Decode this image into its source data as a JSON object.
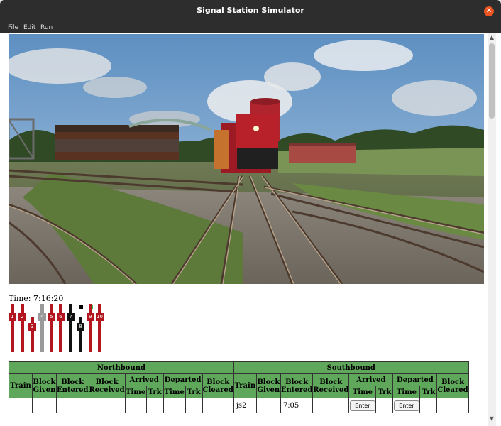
{
  "window": {
    "title": "Signal Station Simulator"
  },
  "menu": [
    "File",
    "Edit",
    "Run"
  ],
  "clock": {
    "label": "Time:",
    "value": "7:16:20"
  },
  "levers": [
    {
      "num": "1",
      "color": "#b3161f",
      "state": "normal"
    },
    {
      "num": "2",
      "color": "#b3161f",
      "state": "normal"
    },
    {
      "num": "3",
      "color": "#b3161f",
      "state": "reversed"
    },
    {
      "num": "4",
      "color": "#9a9a9a",
      "state": "normal"
    },
    {
      "num": "5",
      "color": "#b3161f",
      "state": "normal"
    },
    {
      "num": "6",
      "color": "#b3161f",
      "state": "normal"
    },
    {
      "num": "7",
      "color": "#111111",
      "state": "normal"
    },
    {
      "num": "8",
      "color": "#111111",
      "state": "reversed"
    },
    {
      "num": "9",
      "color": "#b3161f",
      "state": "normal"
    },
    {
      "num": "10",
      "color": "#b3161f",
      "state": "normal"
    }
  ],
  "indicators": [
    {
      "color": "#000000"
    },
    {
      "color": "#22cc44"
    }
  ],
  "sheet": {
    "north_title": "Northbound",
    "south_title": "Southbound",
    "headers": {
      "train": "Train",
      "block_given": "Block Given",
      "block_entered": "Block Entered",
      "block_received": "Block Received",
      "arrived": "Arrived",
      "departed": "Departed",
      "block_cleared": "Block Cleared",
      "time": "Time",
      "trk": "Trk"
    },
    "south_row": {
      "train": "js2",
      "block_entered": "7:05",
      "enter_arrived": "Enter",
      "enter_departed": "Enter"
    }
  },
  "colors": {
    "header_green": "#5fa75a",
    "titlebar": "#2d2d2d",
    "close": "#e95420"
  }
}
